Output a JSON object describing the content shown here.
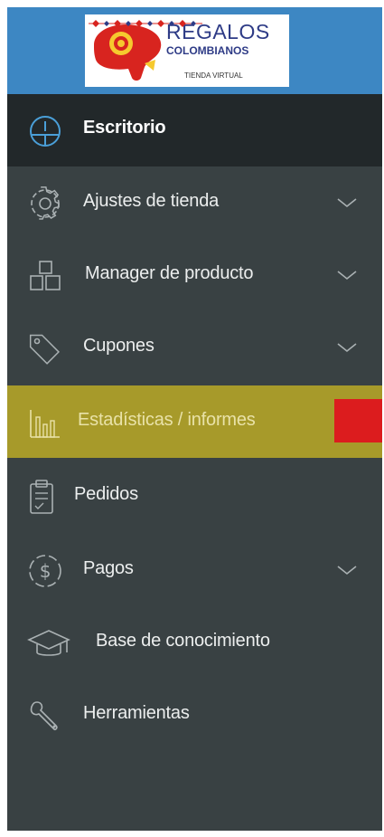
{
  "brand": {
    "title": "REGALOS",
    "subtitle": "COLOMBIANOS",
    "tagline": "TIENDA VIRTUAL",
    "colors": {
      "blue": "#2e3b86",
      "red": "#d8241f",
      "yellow": "#f6c92e"
    }
  },
  "sidebar": {
    "colors": {
      "background": "#394143",
      "active": "#22282a",
      "highlight": "#a79a2a",
      "marker": "#dc1c1e",
      "header": "#3d87c3"
    },
    "items": [
      {
        "label": "Escritorio",
        "icon": "dashboard-icon",
        "state": "active",
        "has_submenu": false
      },
      {
        "label": "Ajustes de tienda",
        "icon": "gear-icon",
        "state": "normal",
        "has_submenu": true
      },
      {
        "label": "Manager de producto",
        "icon": "boxes-icon",
        "state": "normal",
        "has_submenu": true
      },
      {
        "label": "Cupones",
        "icon": "tag-icon",
        "state": "normal",
        "has_submenu": true
      },
      {
        "label": "Estadísticas / informes",
        "icon": "bar-chart-icon",
        "state": "highlighted",
        "has_submenu": true
      },
      {
        "label": "Pedidos",
        "icon": "clipboard-icon",
        "state": "normal",
        "has_submenu": false
      },
      {
        "label": "Pagos",
        "icon": "dollar-icon",
        "state": "normal",
        "has_submenu": true
      },
      {
        "label": "Base de conocimiento",
        "icon": "graduation-cap-icon",
        "state": "normal",
        "has_submenu": false
      },
      {
        "label": "Herramientas",
        "icon": "wrench-icon",
        "state": "normal",
        "has_submenu": false
      }
    ]
  }
}
